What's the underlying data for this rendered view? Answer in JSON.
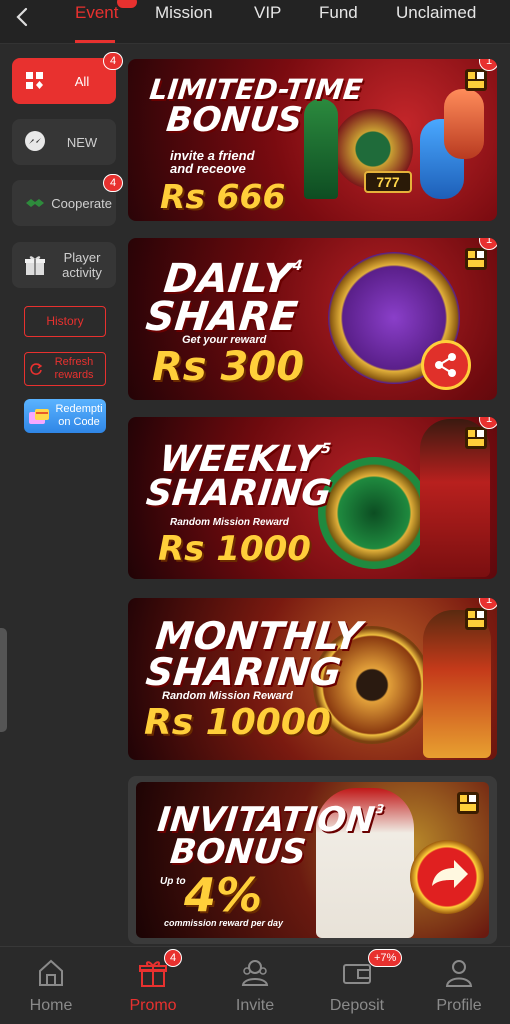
{
  "top_tabs": [
    {
      "label": "Event",
      "active": true
    },
    {
      "label": "Mission"
    },
    {
      "label": "VIP"
    },
    {
      "label": "Fund"
    },
    {
      "label": "Unclaimed"
    }
  ],
  "sidebar": {
    "items": [
      {
        "label": "All",
        "badge": "4",
        "active": true,
        "icon": "grid-icon"
      },
      {
        "label": "NEW",
        "icon": "messenger-icon"
      },
      {
        "label": "Cooperate",
        "badge": "4",
        "icon": "handshake-icon"
      },
      {
        "label": "Player activity",
        "icon": "gift-icon"
      }
    ],
    "history_label": "History",
    "refresh_label": "Refresh rewards",
    "redeem_label": "Redempti on Code"
  },
  "banners": [
    {
      "title_line1": "LIMITED-TIME",
      "title_line2": "BONUS",
      "sub_line1": "invite a friend",
      "sub_line2": "and receove",
      "amount": "Rs 666",
      "badge": "1"
    },
    {
      "title_line1": "DAILY",
      "title_line2": "SHARE",
      "sub_line1": "Get your reward",
      "sub_line2": "",
      "amount": "Rs 300",
      "badge": "1",
      "step": "4"
    },
    {
      "title_line1": "WEEKLY",
      "title_line2": "SHARING",
      "sub_line1": "Random Mission Reward",
      "sub_line2": "",
      "amount": "Rs 1000",
      "badge": "1",
      "step": "5"
    },
    {
      "title_line1": "MONTHLY",
      "title_line2": "SHARING",
      "sub_line1": "Random Mission Reward",
      "sub_line2": "",
      "amount": "Rs 10000",
      "badge": "1"
    },
    {
      "title_line1": "INVITATION",
      "title_line2": "BONUS",
      "sub_line1": "Up to",
      "sub_line2": "commission reward per day",
      "amount": "4%",
      "step": "3"
    }
  ],
  "bottom_nav": [
    {
      "label": "Home",
      "icon": "home-icon"
    },
    {
      "label": "Promo",
      "icon": "gift-icon",
      "badge": "4",
      "active": true
    },
    {
      "label": "Invite",
      "icon": "invite-icon"
    },
    {
      "label": "Deposit",
      "icon": "wallet-icon",
      "badge": "+7%"
    },
    {
      "label": "Profile",
      "icon": "profile-icon"
    }
  ],
  "colors": {
    "accent": "#e8312f",
    "background": "#2b2b2b",
    "gold": "#ffcf3a"
  }
}
